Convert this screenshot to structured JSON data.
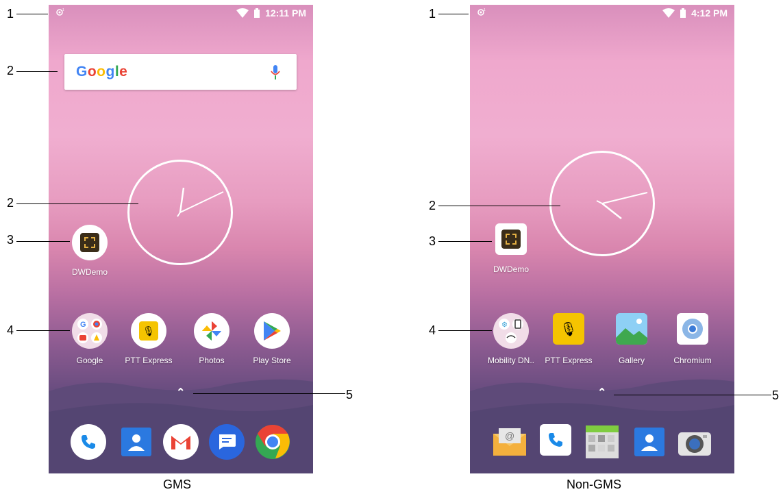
{
  "left_phone": {
    "status_time": "12:11 PM",
    "search_brand": "Google",
    "apps": [
      "DWDemo"
    ],
    "hotseat": [
      "Google",
      "PTT Express",
      "Photos",
      "Play Store"
    ],
    "caption": "GMS"
  },
  "right_phone": {
    "status_time": "4:12 PM",
    "apps": [
      "DWDemo"
    ],
    "hotseat": [
      "Mobility DN..",
      "PTT Express",
      "Gallery",
      "Chromium"
    ],
    "caption": "Non-GMS"
  },
  "callouts": {
    "c1": "1",
    "c2": "2",
    "c3": "3",
    "c4": "4",
    "c5": "5"
  },
  "colors": {
    "google_blue": "#4285f4",
    "google_red": "#ea4335",
    "google_yellow": "#fbbc05",
    "google_green": "#34a853",
    "ptt_yellow": "#f5c400"
  }
}
